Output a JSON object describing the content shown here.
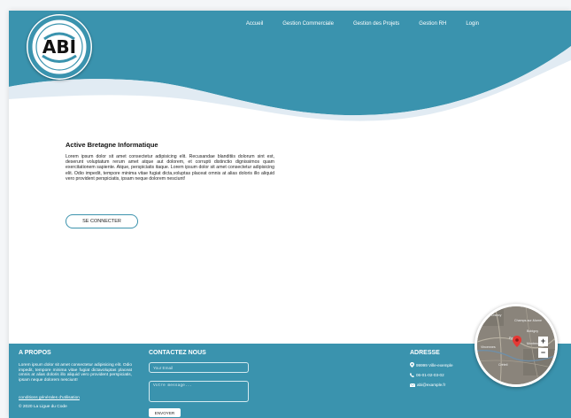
{
  "nav": {
    "items": [
      "Accueil",
      "Gestion Commerciale",
      "Gestion des Projets",
      "Gestion RH",
      "Login"
    ]
  },
  "logo": {
    "text": "ABI"
  },
  "main": {
    "title": "Active Bretagne Informatique",
    "body": "Lorem ipsum dolor sit amet consectetur adipisicing elit. Recusandae blanditiis dolorum sint est, deserunt voluptatum rerum amet atque aut dolorem, et corrupti distinctio dignissimos quam exercitationem sapiente. Atque, perspiciatis itaque. Lorem ipsum dolor sit amet consectetur adipisicing elit. Odio impedit, tempore minima vitae fugiat dicta,voluptas placeat omnis at alias doloris illo aliquid vero provident perspiciatis, ipsam neque dolorem nesciunt!",
    "connect_label": "SE CONNECTER"
  },
  "footer": {
    "about_title": "A PROPOS",
    "about_text": "Lorem ipsum dolor sit amet consectetur adipisicing elit. Odio impedit, tempore minima vitae fugiat dictavoluptas placeat omnis at alias doloris illo aliquid vero provident perspiciatis, ipsam neque dolorem nesciunt!",
    "terms_link": "conditions générales d'utilisation",
    "copyright": "© 2020 La Ligue du Code",
    "contact_title": "CONTACTEZ NOUS",
    "email_placeholder": "Your Email",
    "message_placeholder": "Votre message...",
    "send_label": "ENVOYER",
    "address_title": "ADRESSE",
    "address": "99999 Ville-exemple",
    "phone": "06-01-02-03-02",
    "email": "abi@example.fr"
  },
  "map": {
    "labels": [
      "Drancy",
      "Champs-sur-Marne",
      "Bobigny",
      "Paris",
      "Vincennes",
      "Créteil",
      "Montreuil"
    ],
    "zoom_in": "+",
    "zoom_out": "−"
  },
  "colors": {
    "primary": "#3a93ae",
    "wave_light": "#dce8f1",
    "pin": "#e53935"
  }
}
